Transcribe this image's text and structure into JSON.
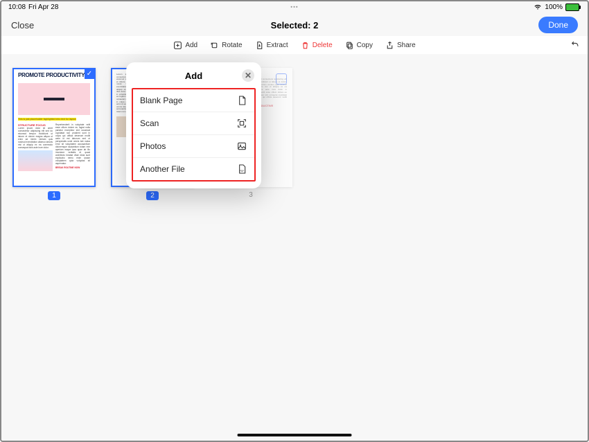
{
  "status": {
    "time": "10:08",
    "date": "Fri Apr 28",
    "battery": "100%"
  },
  "nav": {
    "close": "Close",
    "title": "Selected: 2",
    "done": "Done"
  },
  "toolbar": {
    "add": "Add",
    "rotate": "Rotate",
    "extract": "Extract",
    "delete": "Delete",
    "copy": "Copy",
    "share": "Share"
  },
  "pages": {
    "labels": [
      "1",
      "2",
      "3"
    ],
    "doc_headline": "PROMOTE PRODUCTIVITY"
  },
  "popover": {
    "title": "Add",
    "items": {
      "blank": "Blank Page",
      "scan": "Scan",
      "photos": "Photos",
      "another": "Another File"
    }
  }
}
